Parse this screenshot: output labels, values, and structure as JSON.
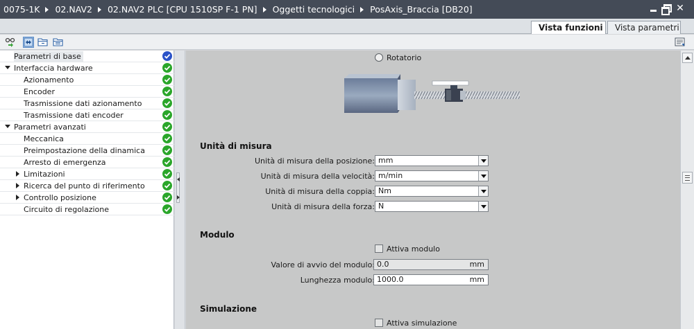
{
  "window": {
    "breadcrumb": [
      "0075-1K",
      "02.NAV2",
      "02.NAV2 PLC [CPU 1510SP F-1 PN]",
      "Oggetti tecnologici",
      "PosAxis_Braccia [DB20]"
    ],
    "controls": [
      "minimize-icon",
      "restore-icon",
      "close-icon"
    ]
  },
  "tabs": [
    {
      "label": "Vista funzioni",
      "active": true
    },
    {
      "label": "Vista parametri",
      "active": false
    }
  ],
  "toolbar": {
    "icons": [
      "navigation-icon",
      "expand-all-icon",
      "collapse-folder-icon",
      "folder-tree-icon"
    ],
    "right_icon": "pane-settings-icon"
  },
  "nav": {
    "items": [
      {
        "label": "Parametri di base",
        "level": 0,
        "expander": "none",
        "status": "ok-blue",
        "selected": true
      },
      {
        "label": "Interfaccia hardware",
        "level": 0,
        "expander": "down",
        "status": "ok"
      },
      {
        "label": "Azionamento",
        "level": 1,
        "expander": "none",
        "status": "ok"
      },
      {
        "label": "Encoder",
        "level": 1,
        "expander": "none",
        "status": "ok"
      },
      {
        "label": "Trasmissione dati azionamento",
        "level": 1,
        "expander": "none",
        "status": "ok"
      },
      {
        "label": "Trasmissione dati encoder",
        "level": 1,
        "expander": "none",
        "status": "ok"
      },
      {
        "label": "Parametri avanzati",
        "level": 0,
        "expander": "down",
        "status": "ok"
      },
      {
        "label": "Meccanica",
        "level": 1,
        "expander": "none",
        "status": "ok"
      },
      {
        "label": "Preimpostazione della dinamica",
        "level": 1,
        "expander": "none",
        "status": "ok"
      },
      {
        "label": "Arresto di emergenza",
        "level": 1,
        "expander": "none",
        "status": "ok"
      },
      {
        "label": "Limitazioni",
        "level": 1,
        "expander": "right",
        "status": "ok"
      },
      {
        "label": "Ricerca del punto di riferimento",
        "level": 1,
        "expander": "right",
        "status": "ok"
      },
      {
        "label": "Controllo posizione",
        "level": 1,
        "expander": "right",
        "status": "ok"
      },
      {
        "label": "Circuito di regolazione",
        "level": 1,
        "expander": "none",
        "status": "ok"
      }
    ]
  },
  "content": {
    "rotatorio_label": "Rotatorio",
    "unita": {
      "title": "Unità di misura",
      "fields": [
        {
          "label": "Unità di misura della posizione:",
          "value": "mm"
        },
        {
          "label": "Unità di misura della velocità:",
          "value": "m/min"
        },
        {
          "label": "Unità di misura della coppia:",
          "value": "Nm"
        },
        {
          "label": "Unità di misura della forza:",
          "value": "N"
        }
      ]
    },
    "modulo": {
      "title": "Modulo",
      "checkbox_label": "Attiva modulo",
      "fields": [
        {
          "label": "Valore di avvio del modulo:",
          "value": "0.0",
          "unit": "mm"
        },
        {
          "label": "Lunghezza modulo:",
          "value": "1000.0",
          "unit": "mm"
        }
      ]
    },
    "simulazione": {
      "title": "Simulazione",
      "checkbox_label": "Attiva simulazione"
    }
  },
  "colors": {
    "titlebar": "#444b57",
    "content_bg": "#c7c8c8",
    "status_ok": "#2aa62a",
    "status_blue": "#2a52c8"
  }
}
